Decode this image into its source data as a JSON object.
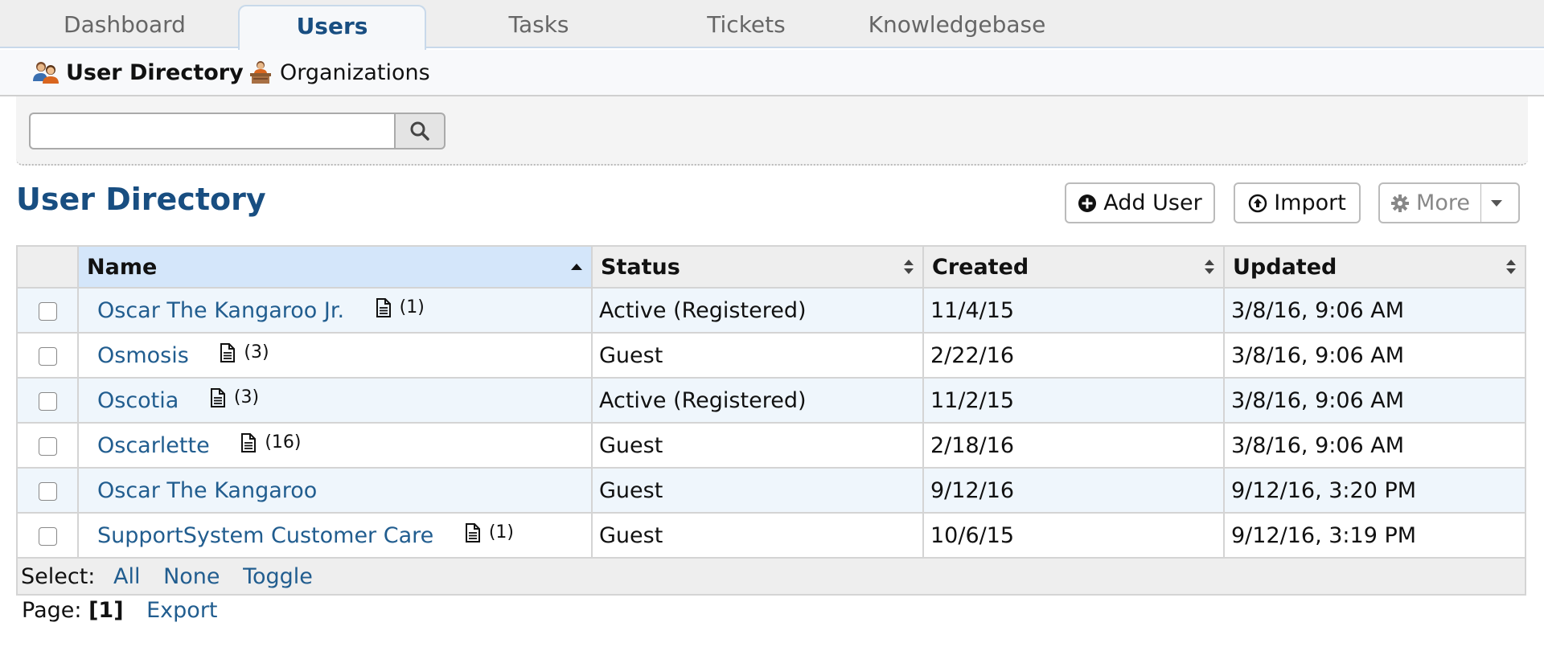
{
  "tabs": [
    {
      "label": "Dashboard",
      "active": false
    },
    {
      "label": "Users",
      "active": true
    },
    {
      "label": "Tasks",
      "active": false
    },
    {
      "label": "Tickets",
      "active": false
    },
    {
      "label": "Knowledgebase",
      "active": false
    }
  ],
  "subnav": [
    {
      "label": "User Directory",
      "icon": "users-icon",
      "active": true
    },
    {
      "label": "Organizations",
      "icon": "organization-icon",
      "active": false
    }
  ],
  "search": {
    "value": "",
    "placeholder": ""
  },
  "page_title": "User Directory",
  "actions": {
    "add_user": "Add User",
    "import": "Import",
    "more": "More"
  },
  "table": {
    "columns": [
      "Name",
      "Status",
      "Created",
      "Updated"
    ],
    "rows": [
      {
        "name": "Oscar The Kangaroo Jr.",
        "notes": "(1)",
        "status": "Active (Registered)",
        "created": "11/4/15",
        "updated": "3/8/16, 9:06 AM"
      },
      {
        "name": "Osmosis",
        "notes": "(3)",
        "status": "Guest",
        "created": "2/22/16",
        "updated": "3/8/16, 9:06 AM"
      },
      {
        "name": "Oscotia",
        "notes": "(3)",
        "status": "Active (Registered)",
        "created": "11/2/15",
        "updated": "3/8/16, 9:06 AM"
      },
      {
        "name": "Oscarlette",
        "notes": "(16)",
        "status": "Guest",
        "created": "2/18/16",
        "updated": "3/8/16, 9:06 AM"
      },
      {
        "name": "Oscar The Kangaroo",
        "notes": "",
        "status": "Guest",
        "created": "9/12/16",
        "updated": "9/12/16, 3:20 PM"
      },
      {
        "name": "SupportSystem Customer Care",
        "notes": "(1)",
        "status": "Guest",
        "created": "10/6/15",
        "updated": "9/12/16, 3:19 PM"
      }
    ],
    "select_label": "Select:",
    "select_all": "All",
    "select_none": "None",
    "select_toggle": "Toggle"
  },
  "pager": {
    "label": "Page:",
    "current": "[1]",
    "export": "Export"
  },
  "colors": {
    "accent": "#184e81",
    "link": "#215d8f",
    "row_alt": "#eff6fc",
    "sorted_header": "#d4e6fa"
  }
}
